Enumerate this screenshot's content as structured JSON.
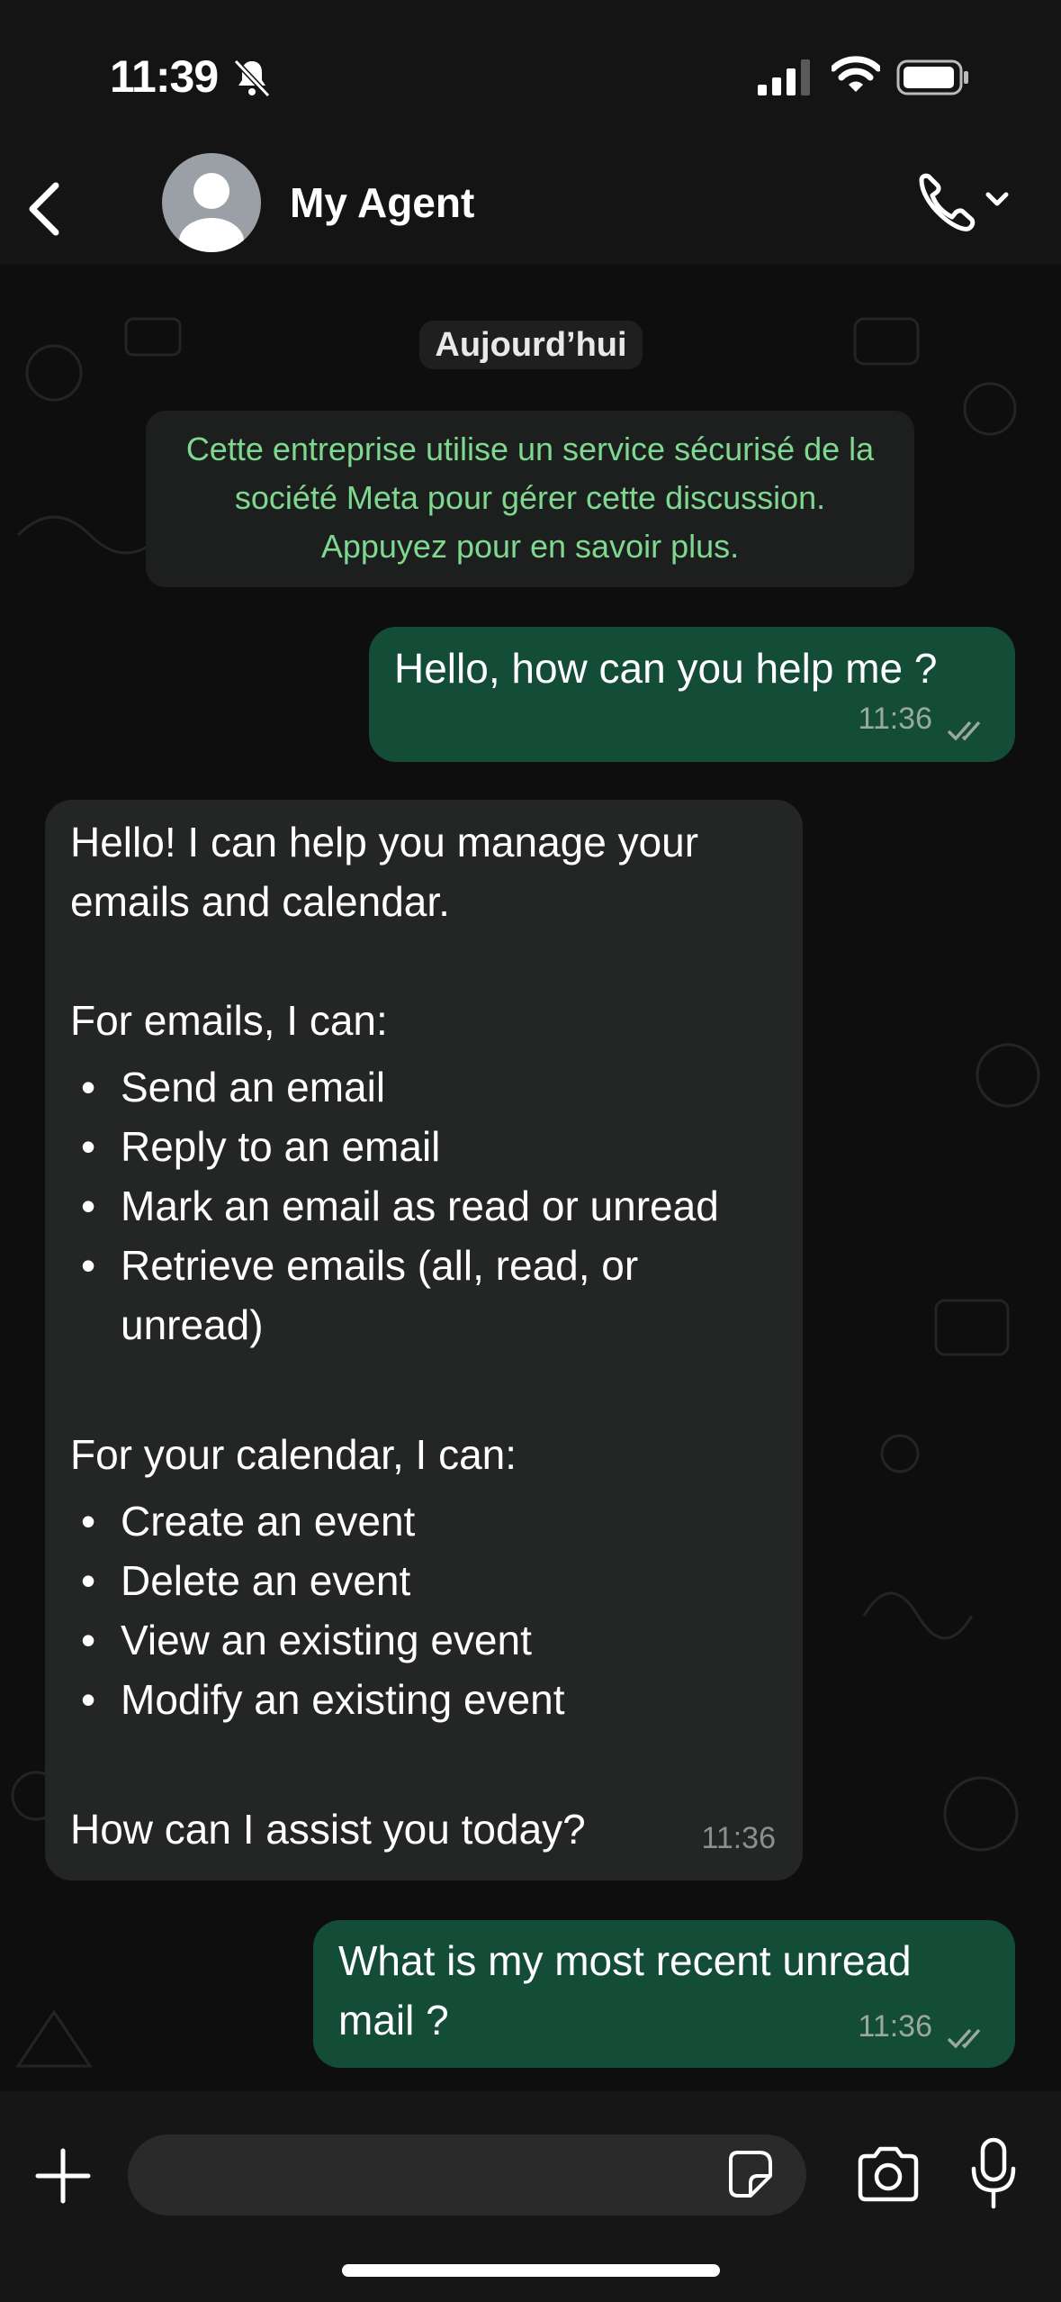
{
  "status_bar": {
    "time": "11:39"
  },
  "header": {
    "contact_name": "My Agent"
  },
  "chat": {
    "date_label": "Aujourd’hui",
    "notice": "Cette entreprise utilise un service sécurisé de la société Meta pour gérer cette discussion. Appuyez pour en savoir plus.",
    "messages": [
      {
        "direction": "out",
        "text": "Hello, how can you help me ?",
        "time": "11:36"
      },
      {
        "direction": "in",
        "intro": "Hello! I can help you manage your emails and calendar.",
        "emails_heading": "For emails, I can:",
        "emails_items": [
          "Send an email",
          "Reply to an email",
          "Mark an email as read or unread",
          "Retrieve emails (all, read, or unread)"
        ],
        "calendar_heading": "For your calendar, I can:",
        "calendar_items": [
          "Create an event",
          "Delete an event",
          "View an existing event",
          "Modify an existing event"
        ],
        "outro": "How can I assist you today?",
        "time": "11:36"
      },
      {
        "direction": "out",
        "text": "What is my most recent unread mail ?",
        "time": "11:36"
      }
    ]
  },
  "input": {
    "placeholder": ""
  },
  "colors": {
    "outgoing_bubble": "#144d37",
    "incoming_bubble": "#242626",
    "notice_text": "#7fd890"
  },
  "icons": [
    "back-chevron-icon",
    "avatar-icon",
    "phone-icon",
    "chevron-down-icon",
    "bell-slash-icon",
    "signal-icon",
    "wifi-icon",
    "battery-icon",
    "plus-icon",
    "sticker-icon",
    "camera-icon",
    "microphone-icon",
    "double-check-icon"
  ]
}
